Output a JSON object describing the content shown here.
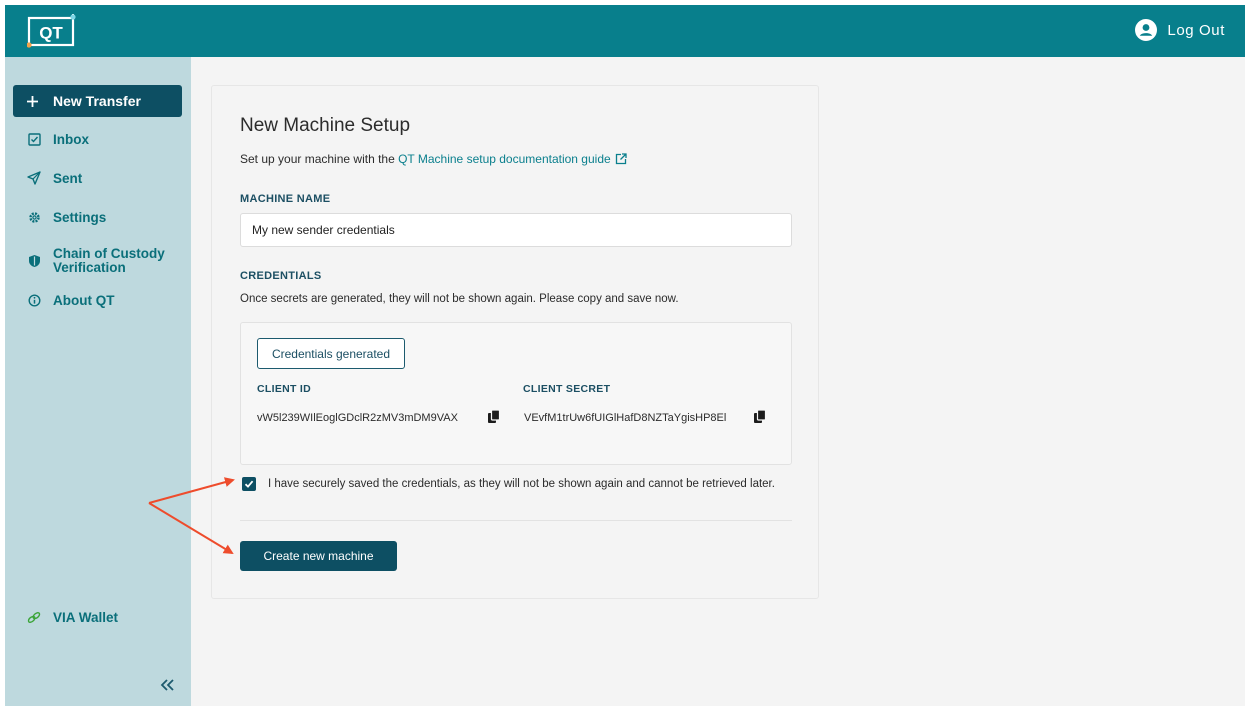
{
  "header": {
    "logo_text": "QT",
    "logout_label": "Log Out"
  },
  "sidebar": {
    "items": [
      {
        "label": "New Transfer",
        "icon": "plus-icon",
        "active": true
      },
      {
        "label": "Inbox",
        "icon": "inbox-icon"
      },
      {
        "label": "Sent",
        "icon": "send-icon"
      },
      {
        "label": "Settings",
        "icon": "gear-icon"
      },
      {
        "label_line1": "Chain of Custody",
        "label_line2": "Verification",
        "icon": "shield-icon"
      },
      {
        "label": "About QT",
        "icon": "info-icon"
      }
    ],
    "wallet_label": "VIA Wallet",
    "collapse_icon": "double-chevron-left-icon"
  },
  "main": {
    "title": "New Machine Setup",
    "subtitle_prefix": "Set up your machine with the ",
    "doc_link": "QT Machine setup documentation guide",
    "machine_name_label": "MACHINE NAME",
    "machine_name_value": "My new sender credentials",
    "credentials_label": "CREDENTIALS",
    "credentials_help": "Once secrets are generated, they will not be shown again. Please copy and save now.",
    "generated_button": "Credentials generated",
    "client_id_label": "CLIENT ID",
    "client_id_value": "vW5l239WIlEoglGDclR2zMV3mDM9VAX",
    "client_secret_label": "CLIENT SECRET",
    "client_secret_value": "VEvfM1trUw6fUIGlHafD8NZTaYgisHP8El",
    "confirm_checked": true,
    "confirm_label": "I have securely saved the credentials, as they will not be shown again and cannot be retrieved later.",
    "create_button": "Create new machine"
  },
  "colors": {
    "topbar": "#087f8c",
    "sidebar": "#bed9de",
    "primary": "#0d4f63",
    "link": "#0a7f8d",
    "annotation_arrow": "#ee4c2c"
  }
}
